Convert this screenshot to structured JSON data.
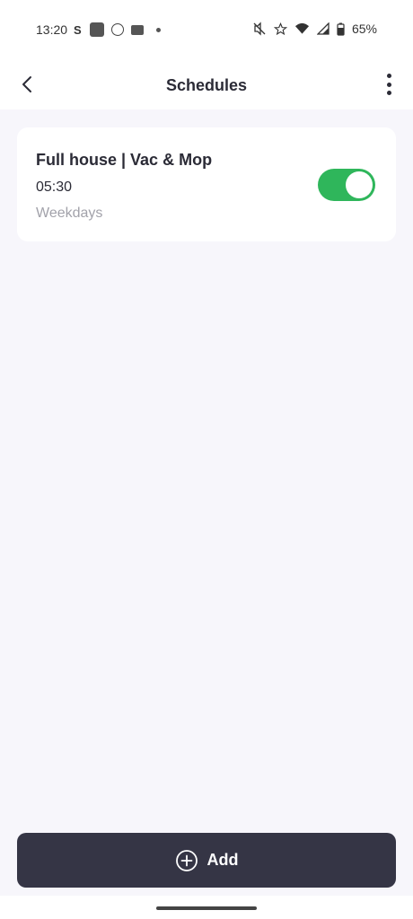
{
  "status_bar": {
    "time": "13:20",
    "left_icons": [
      "s-app-icon",
      "app-square-icon",
      "circle-icon",
      "card-icon",
      "notification-dot-icon"
    ],
    "right_icons": [
      "mute-icon",
      "star-icon",
      "wifi-icon",
      "signal-icon",
      "battery-icon"
    ],
    "battery": "65%",
    "s_label": "S"
  },
  "header": {
    "title": "Schedules"
  },
  "schedules": [
    {
      "title": "Full house | Vac & Mop",
      "time": "05:30",
      "days": "Weekdays",
      "enabled": true
    }
  ],
  "footer": {
    "add_label": "Add"
  },
  "colors": {
    "toggle_on": "#2fb65b",
    "add_button": "#353545",
    "background": "#f7f6fb"
  }
}
